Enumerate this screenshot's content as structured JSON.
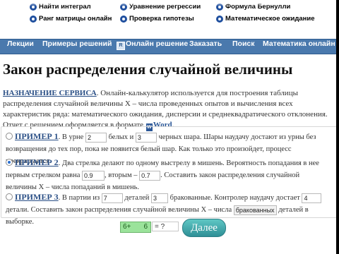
{
  "top_links": [
    {
      "label": "Найти интеграл"
    },
    {
      "label": "Уравнение регрессии"
    },
    {
      "label": "Формула Бернулли"
    },
    {
      "label": "Ранг матрицы онлайн"
    },
    {
      "label": "Проверка гипотезы"
    },
    {
      "label": "Математическое ожидание"
    }
  ],
  "nav": {
    "items": [
      "Лекции",
      "Примеры решений",
      "Онлайн решение",
      "Заказать",
      "Поиск",
      "Математика онлайн"
    ],
    "online_icon": "R"
  },
  "title": "Закон распределения случайной величины",
  "intro": {
    "lead": "НАЗНАЧЕНИЕ СЕРВИСА",
    "text": ". Онлайн-калькулятор используется для построения таблицы распределения случайной величины X – числа проведенных опытов и вычисления всех характеристик ряда: математического ожидания, дисперсии и среднеквадратического отклонения. Отчет с решением оформляется в формате",
    "word_icon": "W",
    "word_label": "Word",
    "end": "."
  },
  "examples": {
    "ex1": {
      "name": "ПРИМЕР 1",
      "t1": ". В урне",
      "white": "2",
      "t2": "белых и",
      "black": "3",
      "t3": "черных шара. Шары наудачу достают из урны без возвращения до тех пор, пока не появится белый шар. Как только это произойдет, процесс прекращается."
    },
    "ex2": {
      "name": "ПРИМЕР 2",
      "t1": ". Два стрелка делают по одному выстрелу в мишень. Вероятность попадания в нее первым стрелком равна",
      "p1": "0.9",
      "t2": ", вторым –",
      "p2": "0.7",
      "t3": ". Составить закон распределения случайной величины X – числа попаданий в мишень."
    },
    "ex3": {
      "name": "ПРИМЕР 3",
      "t1": ". В партии из",
      "total": "7",
      "t2": "деталей",
      "defect": "3",
      "t3": "бракованные. Контролер наудачу достает",
      "taken": "4",
      "t4": "детали. Составить закон распределения случайной величины X – числа",
      "select": "бракованных",
      "t5": "деталей в выборке."
    }
  },
  "form": {
    "green_left": "6+",
    "green_right": "6",
    "answer": "= ?",
    "next_label": "Далее"
  },
  "colors": {
    "nav": "#4a79ad",
    "accent": "#2a4f86",
    "button": "#3aa3a8",
    "green_field": "#9be39b"
  },
  "icons": {
    "link_bullet": "blue-bullet-icon"
  }
}
